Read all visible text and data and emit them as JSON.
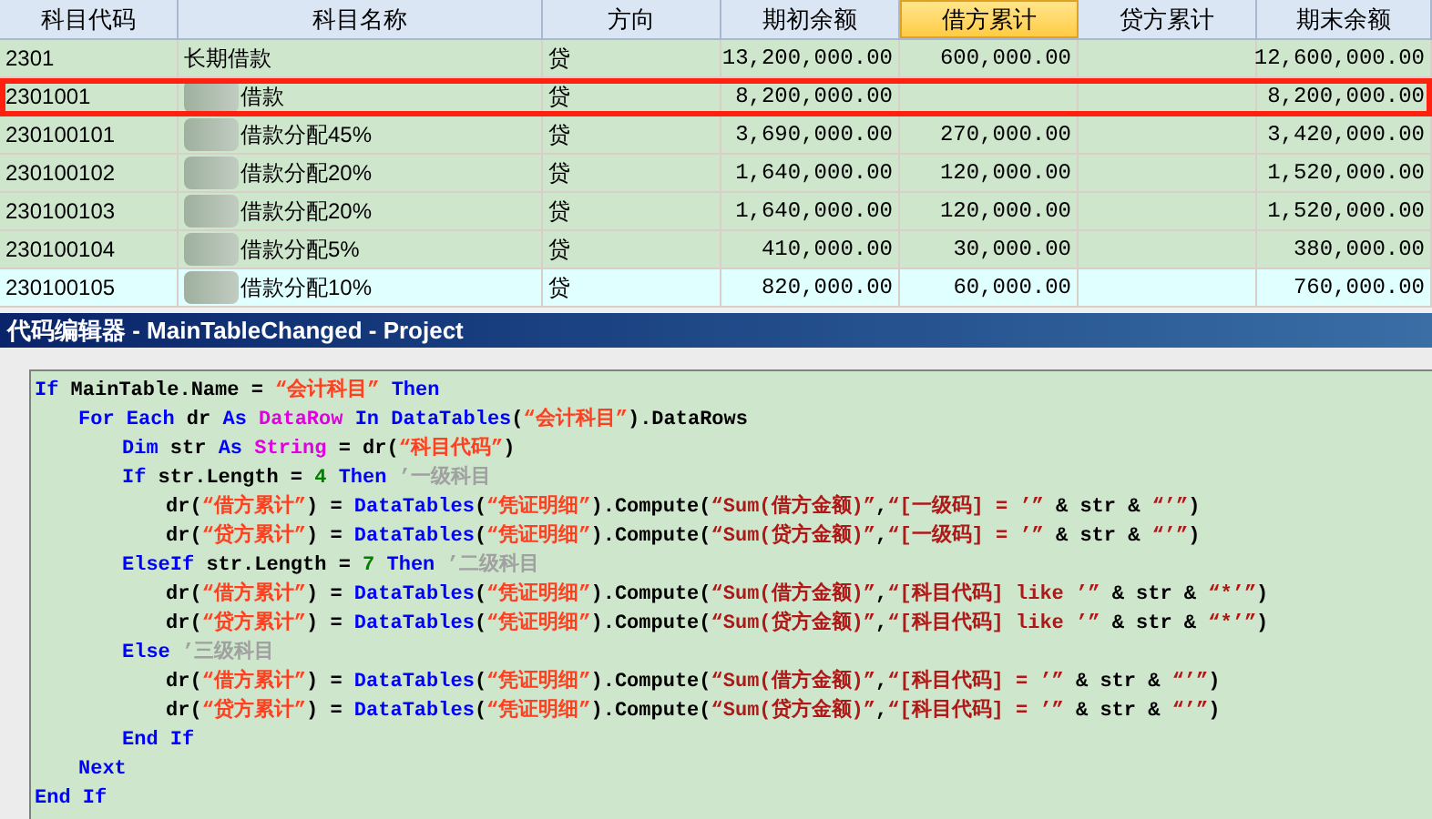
{
  "table": {
    "columns": [
      {
        "label": "科目代码",
        "selected": false
      },
      {
        "label": "科目名称",
        "selected": false
      },
      {
        "label": "方向",
        "selected": false
      },
      {
        "label": "期初余额",
        "selected": false
      },
      {
        "label": "借方累计",
        "selected": true
      },
      {
        "label": "贷方累计",
        "selected": false
      },
      {
        "label": "期末余额",
        "selected": false
      }
    ],
    "rows": [
      {
        "selected": false,
        "highlighted": false,
        "redacted": false,
        "cells": [
          "2301",
          "长期借款",
          "贷",
          "13,200,000.00",
          "600,000.00",
          "",
          "12,600,000.00"
        ]
      },
      {
        "selected": false,
        "highlighted": true,
        "redacted": true,
        "cells": [
          "2301001",
          "借款",
          "贷",
          "8,200,000.00",
          "",
          "",
          "8,200,000.00"
        ]
      },
      {
        "selected": false,
        "highlighted": false,
        "redacted": true,
        "cells": [
          "230100101",
          "借款分配45%",
          "贷",
          "3,690,000.00",
          "270,000.00",
          "",
          "3,420,000.00"
        ]
      },
      {
        "selected": false,
        "highlighted": false,
        "redacted": true,
        "cells": [
          "230100102",
          "借款分配20%",
          "贷",
          "1,640,000.00",
          "120,000.00",
          "",
          "1,520,000.00"
        ]
      },
      {
        "selected": false,
        "highlighted": false,
        "redacted": true,
        "cells": [
          "230100103",
          "借款分配20%",
          "贷",
          "1,640,000.00",
          "120,000.00",
          "",
          "1,520,000.00"
        ]
      },
      {
        "selected": false,
        "highlighted": false,
        "redacted": true,
        "cells": [
          "230100104",
          "借款分配5%",
          "贷",
          "410,000.00",
          "30,000.00",
          "",
          "380,000.00"
        ]
      },
      {
        "selected": true,
        "highlighted": false,
        "redacted": true,
        "cells": [
          "230100105",
          "借款分配10%",
          "贷",
          "820,000.00",
          "60,000.00",
          "",
          "760,000.00"
        ]
      }
    ]
  },
  "editor": {
    "title": "代码编辑器 - MainTableChanged - Project",
    "code": [
      {
        "tokens": [
          {
            "kind": "k",
            "text": "If"
          },
          {
            "kind": "p",
            "text": " MainTable.Name = "
          },
          {
            "kind": "s",
            "text": "“会计科目”"
          },
          {
            "kind": "k",
            "text": " Then"
          }
        ],
        "children": [
          {
            "tokens": [
              {
                "kind": "k",
                "text": "For Each"
              },
              {
                "kind": "p",
                "text": " dr "
              },
              {
                "kind": "k",
                "text": "As"
              },
              {
                "kind": "t",
                "text": " DataRow"
              },
              {
                "kind": "k",
                "text": " In DataTables"
              },
              {
                "kind": "p",
                "text": "("
              },
              {
                "kind": "s",
                "text": "“会计科目”"
              },
              {
                "kind": "p",
                "text": ").DataRows"
              }
            ],
            "children": [
              {
                "tokens": [
                  {
                    "kind": "k",
                    "text": "Dim"
                  },
                  {
                    "kind": "p",
                    "text": " str "
                  },
                  {
                    "kind": "k",
                    "text": "As"
                  },
                  {
                    "kind": "t",
                    "text": " String"
                  },
                  {
                    "kind": "p",
                    "text": " = dr("
                  },
                  {
                    "kind": "s",
                    "text": "“科目代码”"
                  },
                  {
                    "kind": "p",
                    "text": ")"
                  }
                ]
              },
              {
                "tokens": [
                  {
                    "kind": "k",
                    "text": "If"
                  },
                  {
                    "kind": "p",
                    "text": " str.Length = "
                  },
                  {
                    "kind": "n",
                    "text": "4"
                  },
                  {
                    "kind": "k",
                    "text": " Then"
                  },
                  {
                    "kind": "m",
                    "text": " ’一级科目"
                  }
                ],
                "children": [
                  {
                    "tokens": [
                      {
                        "kind": "p",
                        "text": "dr("
                      },
                      {
                        "kind": "s",
                        "text": "“借方累计”"
                      },
                      {
                        "kind": "p",
                        "text": ") = "
                      },
                      {
                        "kind": "k",
                        "text": "DataTables"
                      },
                      {
                        "kind": "p",
                        "text": "("
                      },
                      {
                        "kind": "s",
                        "text": "“凭证明细”"
                      },
                      {
                        "kind": "p",
                        "text": ").Compute("
                      },
                      {
                        "kind": "c",
                        "text": "“Sum(借方金额)”"
                      },
                      {
                        "kind": "p",
                        "text": ","
                      },
                      {
                        "kind": "c",
                        "text": "“[一级码] = ’”"
                      },
                      {
                        "kind": "p",
                        "text": " & str & "
                      },
                      {
                        "kind": "c",
                        "text": "“’”"
                      },
                      {
                        "kind": "p",
                        "text": ")"
                      }
                    ]
                  },
                  {
                    "tokens": [
                      {
                        "kind": "p",
                        "text": "dr("
                      },
                      {
                        "kind": "s",
                        "text": "“贷方累计”"
                      },
                      {
                        "kind": "p",
                        "text": ") = "
                      },
                      {
                        "kind": "k",
                        "text": "DataTables"
                      },
                      {
                        "kind": "p",
                        "text": "("
                      },
                      {
                        "kind": "s",
                        "text": "“凭证明细”"
                      },
                      {
                        "kind": "p",
                        "text": ").Compute("
                      },
                      {
                        "kind": "c",
                        "text": "“Sum(贷方金额)”"
                      },
                      {
                        "kind": "p",
                        "text": ","
                      },
                      {
                        "kind": "c",
                        "text": "“[一级码] = ’”"
                      },
                      {
                        "kind": "p",
                        "text": " & str & "
                      },
                      {
                        "kind": "c",
                        "text": "“’”"
                      },
                      {
                        "kind": "p",
                        "text": ")"
                      }
                    ]
                  }
                ]
              },
              {
                "tokens": [
                  {
                    "kind": "k",
                    "text": "ElseIf"
                  },
                  {
                    "kind": "p",
                    "text": " str.Length = "
                  },
                  {
                    "kind": "n",
                    "text": "7"
                  },
                  {
                    "kind": "k",
                    "text": " Then"
                  },
                  {
                    "kind": "m",
                    "text": " ’二级科目"
                  }
                ],
                "children": [
                  {
                    "tokens": [
                      {
                        "kind": "p",
                        "text": "dr("
                      },
                      {
                        "kind": "s",
                        "text": "“借方累计”"
                      },
                      {
                        "kind": "p",
                        "text": ") = "
                      },
                      {
                        "kind": "k",
                        "text": "DataTables"
                      },
                      {
                        "kind": "p",
                        "text": "("
                      },
                      {
                        "kind": "s",
                        "text": "“凭证明细”"
                      },
                      {
                        "kind": "p",
                        "text": ").Compute("
                      },
                      {
                        "kind": "c",
                        "text": "“Sum(借方金额)”"
                      },
                      {
                        "kind": "p",
                        "text": ","
                      },
                      {
                        "kind": "c",
                        "text": "“[科目代码] like ’”"
                      },
                      {
                        "kind": "p",
                        "text": " & str & "
                      },
                      {
                        "kind": "c",
                        "text": "“*’”"
                      },
                      {
                        "kind": "p",
                        "text": ")"
                      }
                    ]
                  },
                  {
                    "tokens": [
                      {
                        "kind": "p",
                        "text": "dr("
                      },
                      {
                        "kind": "s",
                        "text": "“贷方累计”"
                      },
                      {
                        "kind": "p",
                        "text": ") = "
                      },
                      {
                        "kind": "k",
                        "text": "DataTables"
                      },
                      {
                        "kind": "p",
                        "text": "("
                      },
                      {
                        "kind": "s",
                        "text": "“凭证明细”"
                      },
                      {
                        "kind": "p",
                        "text": ").Compute("
                      },
                      {
                        "kind": "c",
                        "text": "“Sum(贷方金额)”"
                      },
                      {
                        "kind": "p",
                        "text": ","
                      },
                      {
                        "kind": "c",
                        "text": "“[科目代码] like ’”"
                      },
                      {
                        "kind": "p",
                        "text": " & str & "
                      },
                      {
                        "kind": "c",
                        "text": "“*’”"
                      },
                      {
                        "kind": "p",
                        "text": ")"
                      }
                    ]
                  }
                ]
              },
              {
                "tokens": [
                  {
                    "kind": "k",
                    "text": "Else"
                  },
                  {
                    "kind": "m",
                    "text": " ’三级科目"
                  }
                ],
                "children": [
                  {
                    "tokens": [
                      {
                        "kind": "p",
                        "text": "dr("
                      },
                      {
                        "kind": "s",
                        "text": "“借方累计”"
                      },
                      {
                        "kind": "p",
                        "text": ") = "
                      },
                      {
                        "kind": "k",
                        "text": "DataTables"
                      },
                      {
                        "kind": "p",
                        "text": "("
                      },
                      {
                        "kind": "s",
                        "text": "“凭证明细”"
                      },
                      {
                        "kind": "p",
                        "text": ").Compute("
                      },
                      {
                        "kind": "c",
                        "text": "“Sum(借方金额)”"
                      },
                      {
                        "kind": "p",
                        "text": ","
                      },
                      {
                        "kind": "c",
                        "text": "“[科目代码] = ’”"
                      },
                      {
                        "kind": "p",
                        "text": " & str & "
                      },
                      {
                        "kind": "c",
                        "text": "“’”"
                      },
                      {
                        "kind": "p",
                        "text": ")"
                      }
                    ]
                  },
                  {
                    "tokens": [
                      {
                        "kind": "p",
                        "text": "dr("
                      },
                      {
                        "kind": "s",
                        "text": "“贷方累计”"
                      },
                      {
                        "kind": "p",
                        "text": ") = "
                      },
                      {
                        "kind": "k",
                        "text": "DataTables"
                      },
                      {
                        "kind": "p",
                        "text": "("
                      },
                      {
                        "kind": "s",
                        "text": "“凭证明细”"
                      },
                      {
                        "kind": "p",
                        "text": ").Compute("
                      },
                      {
                        "kind": "c",
                        "text": "“Sum(贷方金额)”"
                      },
                      {
                        "kind": "p",
                        "text": ","
                      },
                      {
                        "kind": "c",
                        "text": "“[科目代码] = ’”"
                      },
                      {
                        "kind": "p",
                        "text": " & str & "
                      },
                      {
                        "kind": "c",
                        "text": "“’”"
                      },
                      {
                        "kind": "p",
                        "text": ")"
                      }
                    ]
                  }
                ]
              },
              {
                "tokens": [
                  {
                    "kind": "k",
                    "text": "End If"
                  }
                ]
              }
            ]
          },
          {
            "tokens": [
              {
                "kind": "k",
                "text": "Next"
              }
            ]
          }
        ]
      },
      {
        "tokens": [
          {
            "kind": "k",
            "text": "End If"
          }
        ]
      }
    ]
  }
}
